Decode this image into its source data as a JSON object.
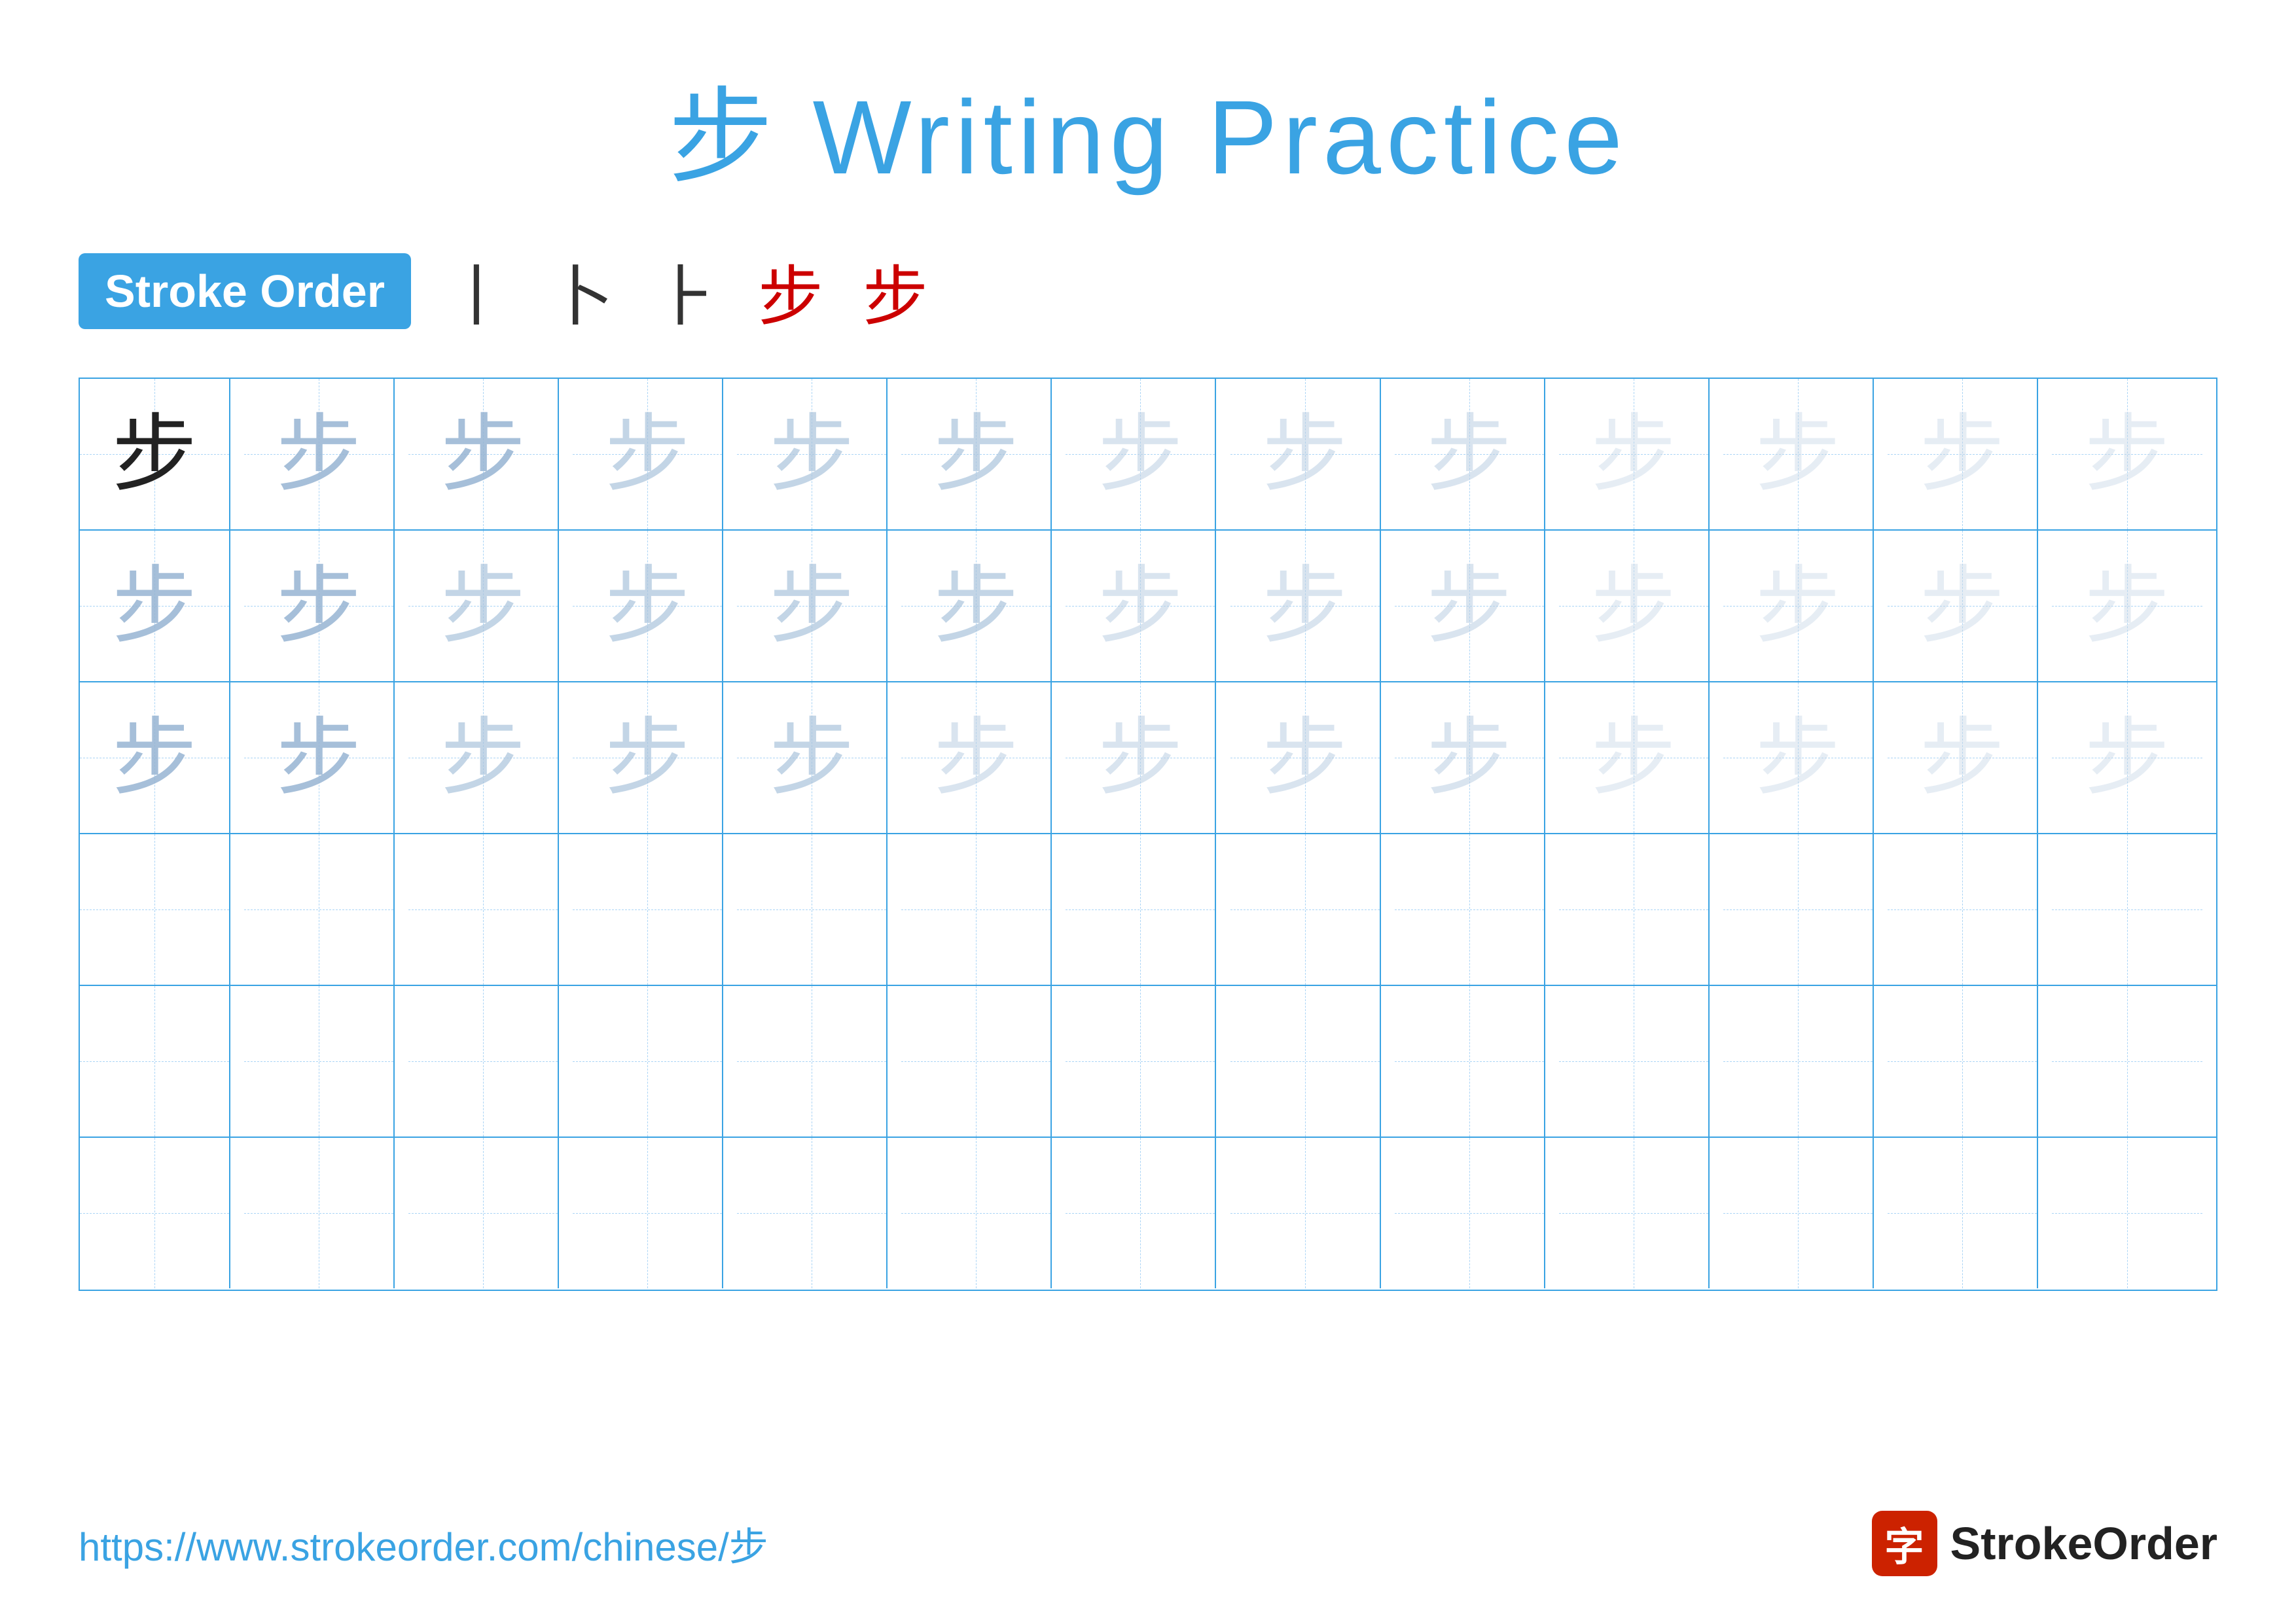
{
  "title": {
    "char": "步",
    "text": "Writing Practice",
    "full": "步 Writing Practice"
  },
  "stroke_order": {
    "badge_label": "Stroke Order",
    "steps": [
      "丨",
      "卜",
      "⺊",
      "步",
      "步"
    ],
    "steps_colors": [
      "dark",
      "dark",
      "dark",
      "red",
      "red"
    ]
  },
  "grid": {
    "rows": 6,
    "cols": 13,
    "char": "步",
    "filled_rows": 3
  },
  "footer": {
    "url": "https://www.strokeorder.com/chinese/步",
    "brand_icon": "字",
    "brand_name": "StrokeOrder"
  }
}
